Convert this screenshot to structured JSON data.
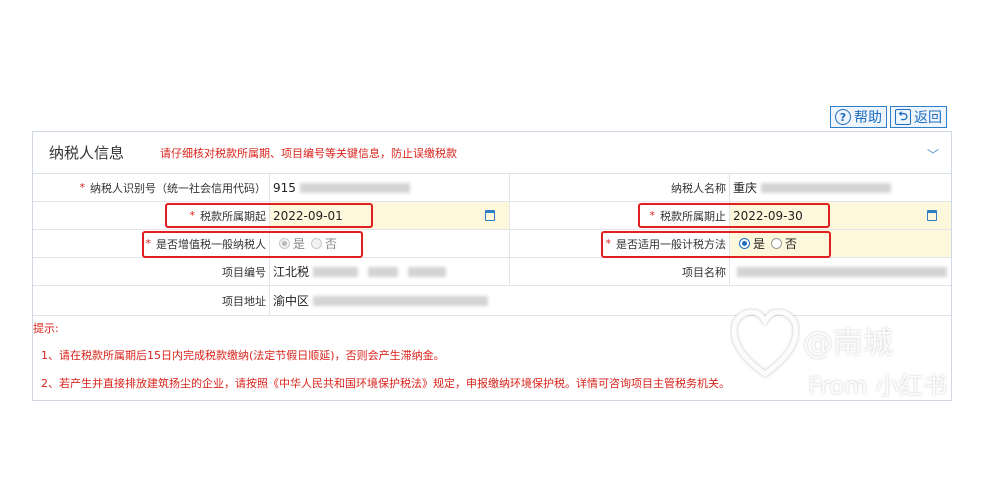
{
  "toolbar": {
    "help_label": "帮助",
    "back_label": "返回"
  },
  "panel": {
    "title": "纳税人信息",
    "warning": "请仔细核对税款所属期、项目编号等关键信息，防止误缴税款"
  },
  "fields": {
    "taxpayer_id_label": "纳税人识别号（统一社会信用代码）",
    "taxpayer_id_value": "915",
    "taxpayer_name_label": "纳税人名称",
    "taxpayer_name_value": "重庆",
    "period_start_label": "税款所属期起",
    "period_start_value": "2022-09-01",
    "period_end_label": "税款所属期止",
    "period_end_value": "2022-09-30",
    "vat_general_label": "是否增值税一般纳税人",
    "vat_yes": "是",
    "vat_no": "否",
    "general_method_label": "是否适用一般计税方法",
    "method_yes": "是",
    "method_no": "否",
    "project_no_label": "项目编号",
    "project_no_value": "江北税",
    "project_name_label": "项目名称",
    "project_addr_label": "项目地址",
    "project_addr_value": "渝中区"
  },
  "tips": {
    "title": "提示:",
    "tip1": "1、请在税款所属期后15日内完成税款缴纳(法定节假日顺延)，否则会产生滞纳金。",
    "tip2": "2、若产生并直接排放建筑扬尘的企业，请按照《中华人民共和国环境保护税法》规定，申报缴纳环境保护税。详情可咨询项目主管税务机关。"
  },
  "watermark": {
    "handle": "@南城",
    "source": "From 小红书"
  }
}
